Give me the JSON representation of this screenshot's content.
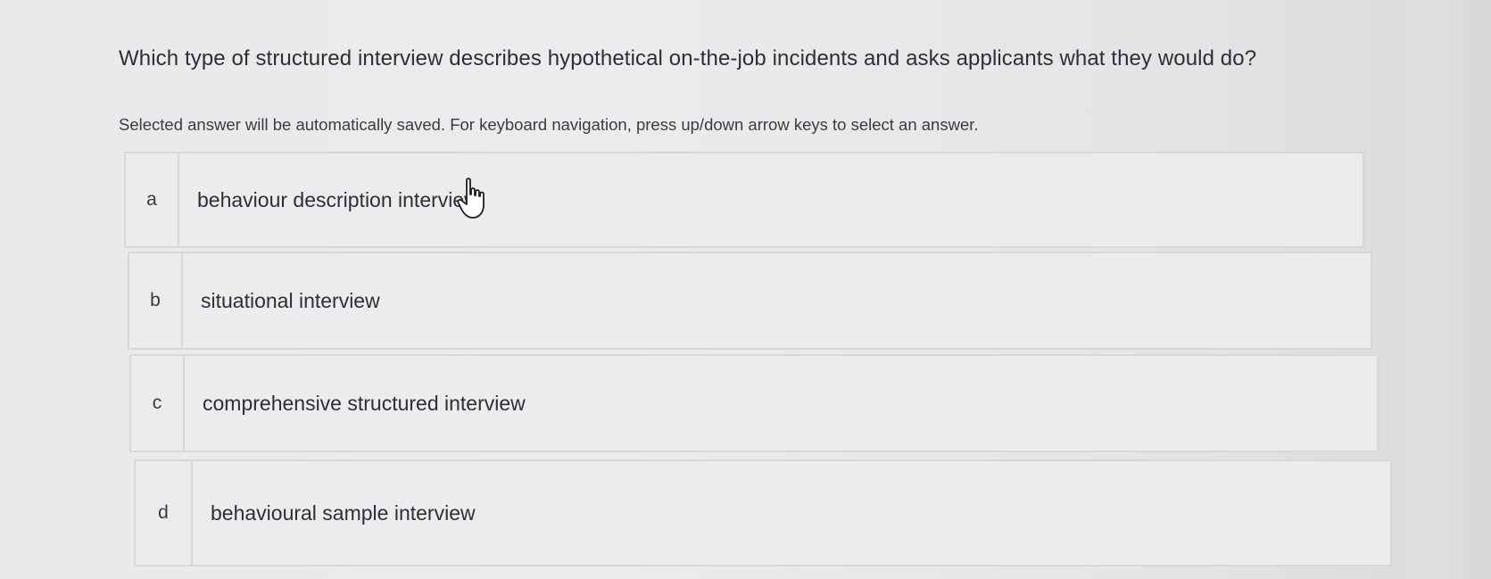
{
  "question": {
    "text": "Which type of structured interview describes hypothetical on-the-job incidents and asks applicants what they would do?"
  },
  "instruction": {
    "text": "Selected answer will be automatically saved. For keyboard navigation, press up/down arrow keys to select an answer."
  },
  "options": [
    {
      "letter": "a",
      "label": "behaviour description interview"
    },
    {
      "letter": "b",
      "label": "situational interview"
    },
    {
      "letter": "c",
      "label": "comprehensive structured interview"
    },
    {
      "letter": "d",
      "label": "behavioural sample interview"
    }
  ],
  "icons": {
    "cursor": "hand-pointer-icon"
  },
  "colors": {
    "background": "#ececee",
    "border": "#d8d8da",
    "text": "#2f2f33"
  }
}
